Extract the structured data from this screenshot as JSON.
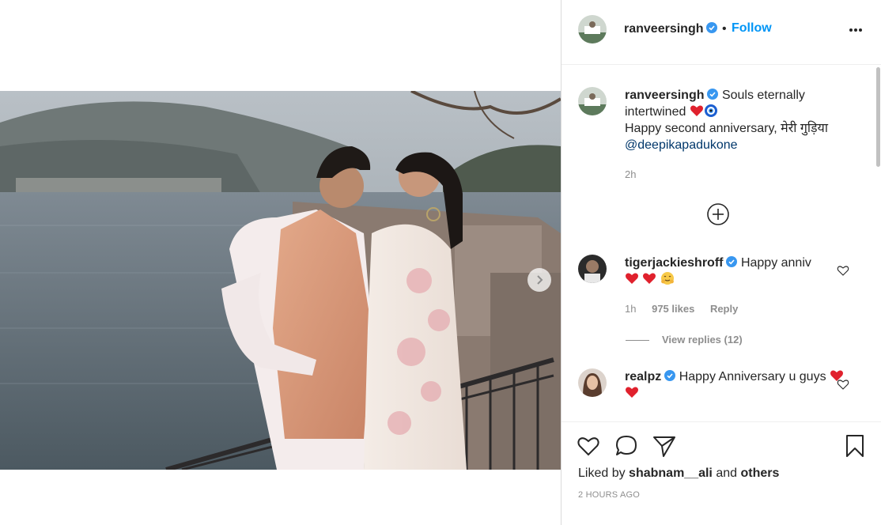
{
  "post": {
    "username": "ranveersingh",
    "separator": "•",
    "follow_label": "Follow",
    "next_label": "›"
  },
  "caption": {
    "username": "ranveersingh",
    "line1": "Souls eternally intertwined",
    "line2": "Happy second anniversary, मेरी गुड़िया",
    "mention": "@deepikapadukone",
    "time": "2h"
  },
  "comments": [
    {
      "username": "tigerjackieshroff",
      "text": "Happy anniv",
      "time": "1h",
      "likes": "975 likes",
      "reply_label": "Reply",
      "view_replies": "View replies (12)"
    },
    {
      "username": "realpz",
      "text": "Happy Anniversary u guys"
    }
  ],
  "footer": {
    "liked_by_prefix": "Liked by",
    "liked_by_user": "shabnam__ali",
    "liked_by_and": "and",
    "liked_by_others": "others",
    "timestamp": "2 HOURS AGO"
  },
  "colors": {
    "accent": "#0095f6",
    "verified": "#3897f0",
    "heart": "#ed4956",
    "text": "#262626",
    "muted": "#8e8e8e"
  },
  "icons": {
    "more": "more-horizontal-icon",
    "like": "heart-outline-icon",
    "comment": "comment-bubble-icon",
    "share": "paper-plane-icon",
    "save": "bookmark-icon",
    "add": "plus-circle-icon",
    "next": "chevron-right-icon"
  }
}
